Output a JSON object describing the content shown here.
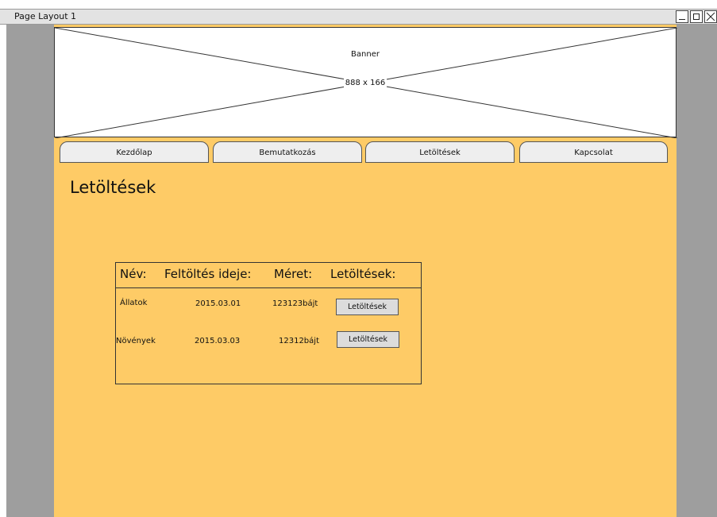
{
  "window": {
    "title": "Page Layout 1"
  },
  "banner": {
    "label": "Banner",
    "size": "888 x 166"
  },
  "nav": {
    "tabs": [
      "Kezdőlap",
      "Bemutatkozás",
      "Letöltések",
      "Kapcsolat"
    ]
  },
  "page": {
    "heading": "Letöltések"
  },
  "table": {
    "headers": [
      "Név:",
      "Feltöltés ideje:",
      "Méret:",
      "Letöltések:"
    ],
    "rows": [
      {
        "name": "Állatok",
        "date": "2015.03.01",
        "size": "123123bájt",
        "button": "Letöltések"
      },
      {
        "name": "Növények",
        "date": "2015.03.03",
        "size": "12312bájt",
        "button": "Letöltések"
      }
    ]
  },
  "colors": {
    "page_background": "#fecb66",
    "canvas": "#9e9e9e"
  }
}
